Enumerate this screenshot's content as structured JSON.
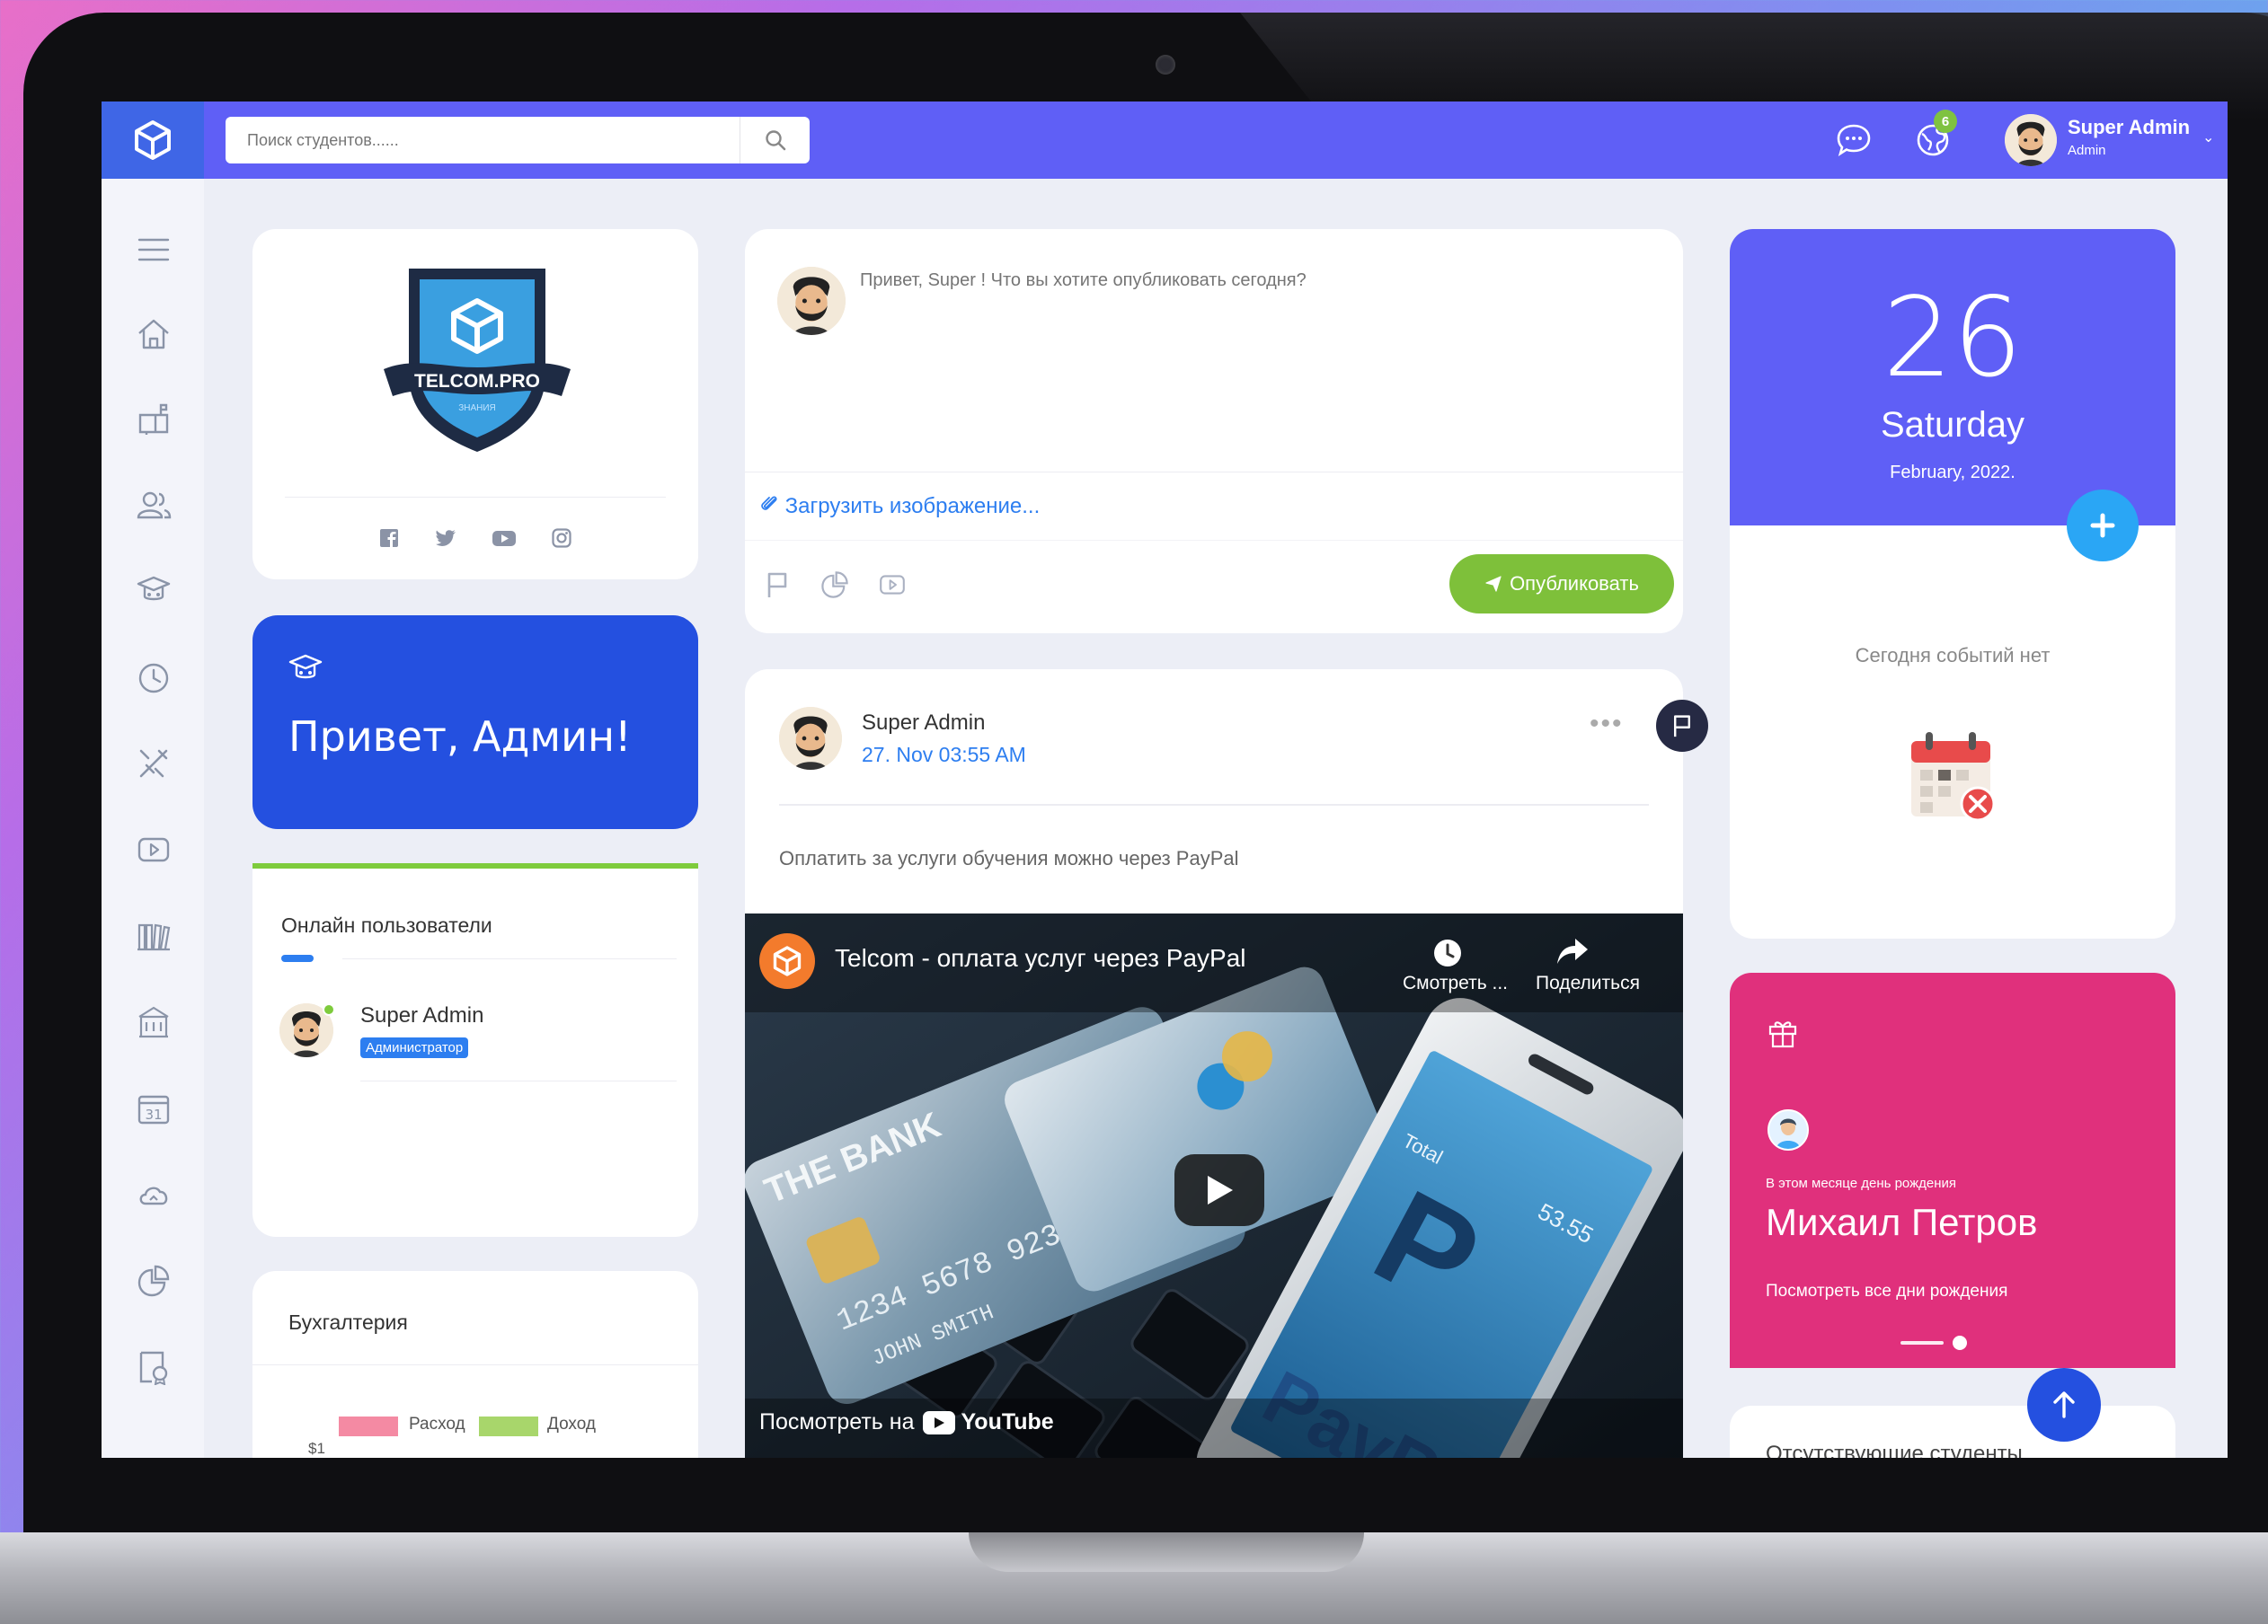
{
  "topbar": {
    "search_placeholder": "Поиск студентов......",
    "notifications_count": "6",
    "user": {
      "name": "Super Admin",
      "role": "Admin"
    }
  },
  "sidebar": {
    "items": [
      "menu-icon",
      "home-icon",
      "mailbox-icon",
      "users-icon",
      "graduation-cap-icon",
      "clock-icon",
      "tools-icon",
      "video-icon",
      "library-icon",
      "building-icon",
      "calendar-icon",
      "cloud-icon",
      "chart-icon",
      "certificate-icon"
    ]
  },
  "profile": {
    "logo_text": "TELCOM.PRO",
    "logo_subtext": "ЗНАНИЯ",
    "social": [
      "facebook-icon",
      "twitter-icon",
      "youtube-icon",
      "instagram-icon"
    ]
  },
  "hello": {
    "text": "Привет, Админ!"
  },
  "online": {
    "title": "Онлайн пользователи",
    "users": [
      {
        "name": "Super Admin",
        "badge": "Администратор"
      }
    ]
  },
  "accounting": {
    "title": "Бухгалтерия",
    "legend": [
      {
        "label": "Расход",
        "color": "#f48aa3"
      },
      {
        "label": "Доход",
        "color": "#a8d66b"
      }
    ],
    "y_tick": "$1"
  },
  "composer": {
    "placeholder": "Привет, Super ! Что вы хотите опубликовать сегодня?",
    "upload_label": "Загрузить изображение...",
    "publish_label": "Опубликовать"
  },
  "post": {
    "author": "Super Admin",
    "date": "27. Nov 03:55 AM",
    "text": "Оплатить за услуги обучения можно через PayPal",
    "video": {
      "title": "Telcom - оплата услуг через PayPal",
      "watch_later": "Смотреть ...",
      "share": "Поделиться",
      "watch_on": "Посмотреть на",
      "youtube": "YouTube"
    }
  },
  "date_card": {
    "day": "26",
    "weekday": "Saturday",
    "month_year": "February, 2022.",
    "no_events": "Сегодня событий нет"
  },
  "birthday": {
    "caption": "В этом месяце день рождения",
    "name": "Михаил Петров",
    "link": "Посмотреть все дни рождения"
  },
  "absent": {
    "title": "Отсутствующие студенты"
  },
  "colors": {
    "primary": "#5f5ff6",
    "blue": "#2450e0",
    "green": "#7ec03a",
    "pink": "#e0307c",
    "link": "#2d7ef0"
  }
}
